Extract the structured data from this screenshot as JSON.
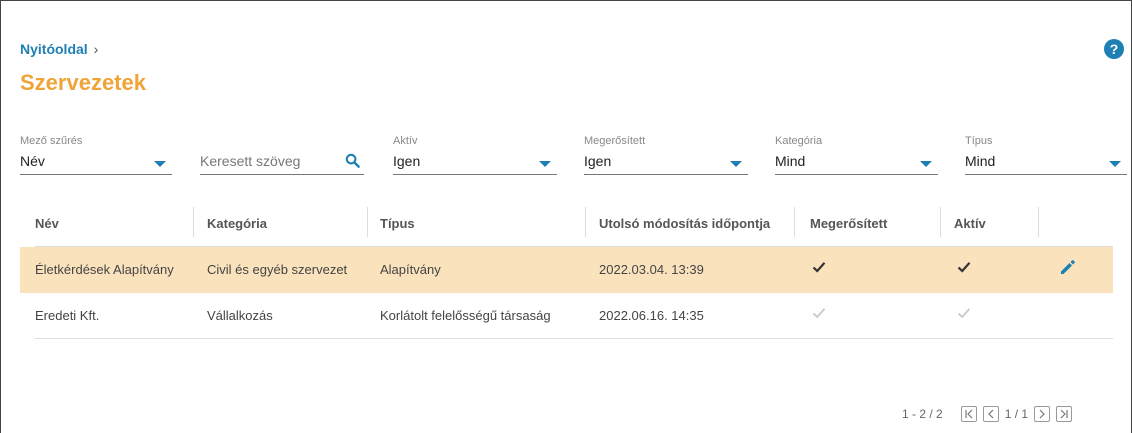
{
  "breadcrumb": {
    "home": "Nyitóoldal",
    "separator": "›"
  },
  "page": {
    "title": "Szervezetek",
    "help": "?"
  },
  "filters": {
    "field": {
      "label": "Mező szűrés",
      "value": "Név"
    },
    "search": {
      "placeholder": "Keresett szöveg"
    },
    "active": {
      "label": "Aktív",
      "value": "Igen"
    },
    "confirmed": {
      "label": "Megerősített",
      "value": "Igen"
    },
    "category": {
      "label": "Kategória",
      "value": "Mind"
    },
    "type": {
      "label": "Típus",
      "value": "Mind"
    }
  },
  "table": {
    "headers": [
      "Név",
      "Kategória",
      "Típus",
      "Utolsó módosítás időpontja",
      "Megerősített",
      "Aktív"
    ],
    "rows": [
      {
        "name": "Életkérdések Alapítvány",
        "category": "Civil és egyéb szervezet",
        "type": "Alapítvány",
        "modified": "2022.03.04. 13:39",
        "confirmed": true,
        "active": true
      },
      {
        "name": "Eredeti Kft.",
        "category": "Vállalkozás",
        "type": "Korlátolt felelősségű társaság",
        "modified": "2022.06.16. 14:35",
        "confirmed": false,
        "active": false
      }
    ]
  },
  "pagination": {
    "range": "1 - 2 / 2",
    "page": "1 / 1"
  },
  "colors": {
    "accent": "#1d7fb3",
    "title": "#f0a437",
    "selected_row": "#fae2bd"
  }
}
